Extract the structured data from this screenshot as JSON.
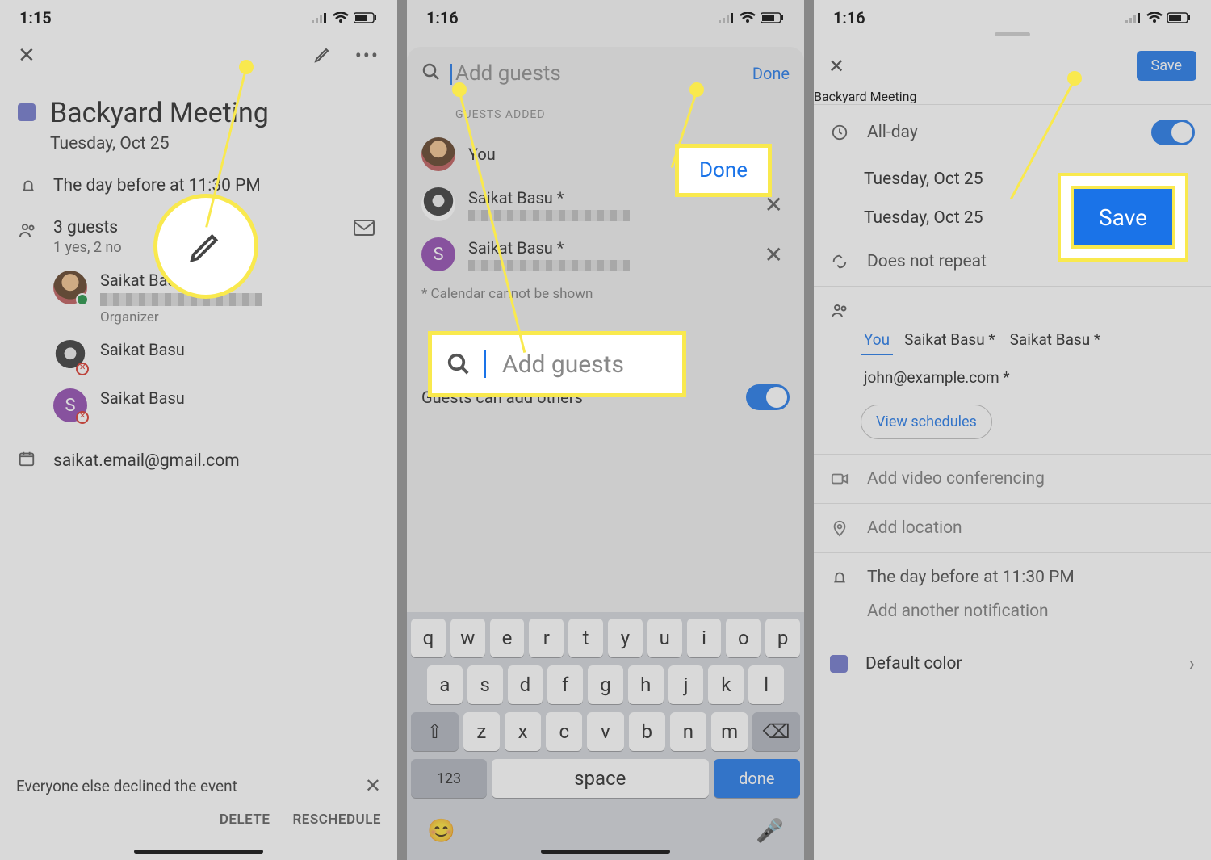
{
  "screen1": {
    "time": "1:15",
    "title": "Backyard Meeting",
    "date": "Tuesday, Oct 25",
    "reminder": "The day before at 11:30 PM",
    "guests_label": "3 guests",
    "guests_sub": "1 yes, 2 no",
    "persons": {
      "p1_name": "Saikat Basu",
      "p1_role": "Organizer",
      "p2_name": "Saikat Basu",
      "p3_name": "Saikat Basu"
    },
    "calendar_email": "saikat.email@gmail.com",
    "declined_msg": "Everyone else declined the event",
    "btn_delete": "DELETE",
    "btn_reschedule": "RESCHEDULE"
  },
  "screen2": {
    "time": "1:16",
    "placeholder": "Add guests",
    "done_label": "Done",
    "section_label": "GUESTS ADDED",
    "you_label": "You",
    "g1_name": "Saikat Basu *",
    "g2_name": "Saikat Basu *",
    "foot_note": "* Calendar cannot be shown",
    "toggle_label": "Guests can add others",
    "done_hl": "Done",
    "add_hl_placeholder": "Add guests",
    "keys": {
      "num": "123",
      "space": "space",
      "done": "done"
    }
  },
  "screen3": {
    "time": "1:16",
    "save": "Save",
    "title": "Backyard Meeting",
    "allday": "All-day",
    "date1": "Tuesday, Oct 25",
    "date2": "Tuesday, Oct 25",
    "repeat": "Does not repeat",
    "chips": {
      "you": "You",
      "g1": "Saikat Basu *",
      "g2": "Saikat Basu *",
      "g3": "john@example.com *"
    },
    "view_schedules": "View schedules",
    "add_video": "Add video conferencing",
    "add_location": "Add location",
    "reminder": "The day before at 11:30 PM",
    "add_notif": "Add another notification",
    "color_label": "Default color",
    "save_hl": "Save"
  }
}
